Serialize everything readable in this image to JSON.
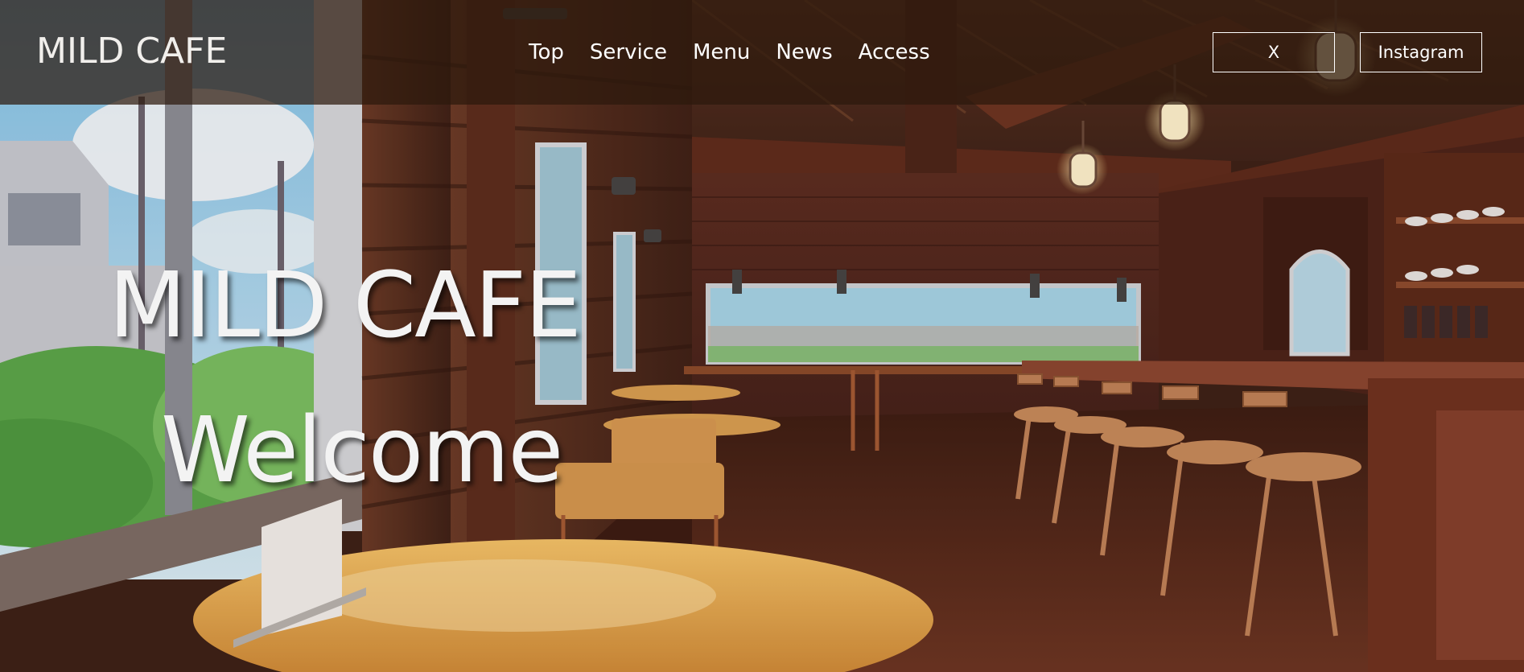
{
  "header": {
    "logo": "MILD CAFE",
    "nav": [
      {
        "label": "Top"
      },
      {
        "label": "Service"
      },
      {
        "label": "Menu"
      },
      {
        "label": "News"
      },
      {
        "label": "Access"
      }
    ],
    "social": {
      "x_label": "X",
      "instagram_label": "Instagram"
    }
  },
  "hero": {
    "title": "MILD CAFE",
    "subtitle": "Welcome"
  },
  "colors": {
    "header_overlay": "#2d190c",
    "text": "#ffffff",
    "wood": "#5a2f1d",
    "table": "#e8a848"
  }
}
